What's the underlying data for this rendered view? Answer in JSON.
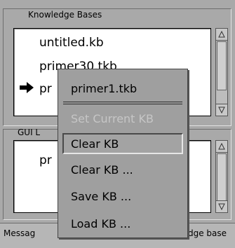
{
  "knowledge_bases": {
    "title": "Knowledge Bases",
    "items": [
      "untitled.kb",
      "primer30.tkb",
      "pr"
    ]
  },
  "gui_libraries": {
    "title_partial": "GUI L",
    "items": [
      "pr"
    ]
  },
  "status": {
    "left_partial": "Messag",
    "right_partial": "dge base"
  },
  "popup_menu": {
    "title": "primer1.tkb",
    "items": [
      "Set Current KB",
      "Clear KB",
      "Clear KB ...",
      "Save KB ...",
      "Load KB ..."
    ]
  },
  "icons": {
    "pointer": "right-arrow-icon",
    "scroll_up": "scroll-up-arrow-icon",
    "scroll_down": "scroll-down-arrow-icon"
  }
}
